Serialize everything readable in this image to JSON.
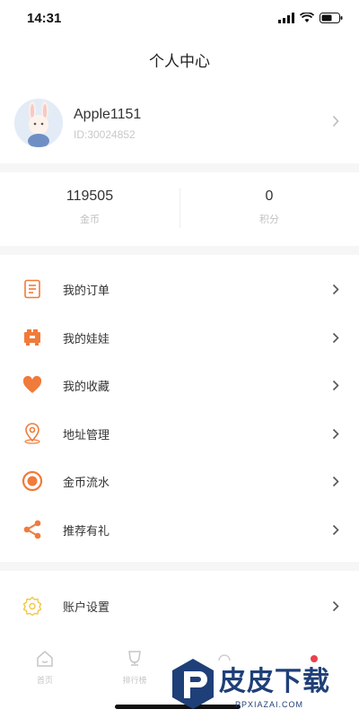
{
  "status_bar": {
    "time": "14:31"
  },
  "header": {
    "title": "个人中心"
  },
  "profile": {
    "username": "Apple1151",
    "user_id": "ID:30024852"
  },
  "stats": [
    {
      "value": "119505",
      "label": "金币"
    },
    {
      "value": "0",
      "label": "积分"
    }
  ],
  "menu": {
    "items": [
      {
        "label": "我的订单",
        "icon": "order-icon"
      },
      {
        "label": "我的娃娃",
        "icon": "doll-icon"
      },
      {
        "label": "我的收藏",
        "icon": "heart-icon"
      },
      {
        "label": "地址管理",
        "icon": "location-icon"
      },
      {
        "label": "金币流水",
        "icon": "coin-flow-icon"
      },
      {
        "label": "推荐有礼",
        "icon": "share-icon"
      }
    ]
  },
  "settings": {
    "label": "账户设置",
    "icon": "settings-icon"
  },
  "tabbar": {
    "tabs": [
      {
        "label": "首页",
        "icon": "home-icon"
      },
      {
        "label": "排行榜",
        "icon": "trophy-icon"
      }
    ]
  },
  "watermark": {
    "title": "皮皮下载",
    "subtitle": "PPXIAZAI.COM"
  },
  "colors": {
    "accent": "#f07b3a",
    "chevron": "#999999",
    "watermark": "#1f3f78"
  }
}
